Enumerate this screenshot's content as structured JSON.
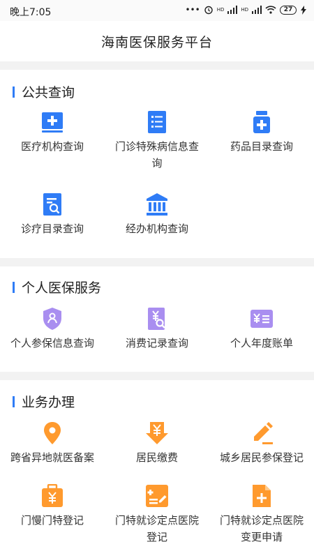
{
  "status_bar": {
    "time": "晚上7:05",
    "dots": "•••",
    "hd1": "HD",
    "hd2": "HD",
    "battery": "27"
  },
  "header": {
    "title": "海南医保服务平台"
  },
  "sections": {
    "public_query": {
      "title": "公共查询",
      "items": [
        {
          "label": "医疗机构查询",
          "icon": "hospital-plus-icon"
        },
        {
          "label": "门诊特殊病信息查询",
          "icon": "list-icon"
        },
        {
          "label": "药品目录查询",
          "icon": "medicine-bottle-icon"
        },
        {
          "label": "诊疗目录查询",
          "icon": "document-search-icon"
        },
        {
          "label": "经办机构查询",
          "icon": "institution-building-icon"
        }
      ]
    },
    "personal": {
      "title": "个人医保服务",
      "items": [
        {
          "label": "个人参保信息查询",
          "icon": "user-shield-icon"
        },
        {
          "label": "消费记录查询",
          "icon": "yuan-search-icon"
        },
        {
          "label": "个人年度账单",
          "icon": "yuan-bill-icon"
        }
      ]
    },
    "business": {
      "title": "业务办理",
      "items": [
        {
          "label": "跨省异地就医备案",
          "icon": "location-pin-icon"
        },
        {
          "label": "居民缴费",
          "icon": "yuan-download-icon"
        },
        {
          "label": "城乡居民参保登记",
          "icon": "edit-pen-icon"
        },
        {
          "label": "门慢门特登记",
          "icon": "yuan-briefcase-icon"
        },
        {
          "label": "门特就诊定点医院登记",
          "icon": "form-edit-icon"
        },
        {
          "label": "门特就诊定点医院变更申请",
          "icon": "document-plus-icon"
        }
      ]
    }
  },
  "colors": {
    "blue": "#2f7cf6",
    "purple": "#a98ef0",
    "orange": "#ff9a2e"
  }
}
